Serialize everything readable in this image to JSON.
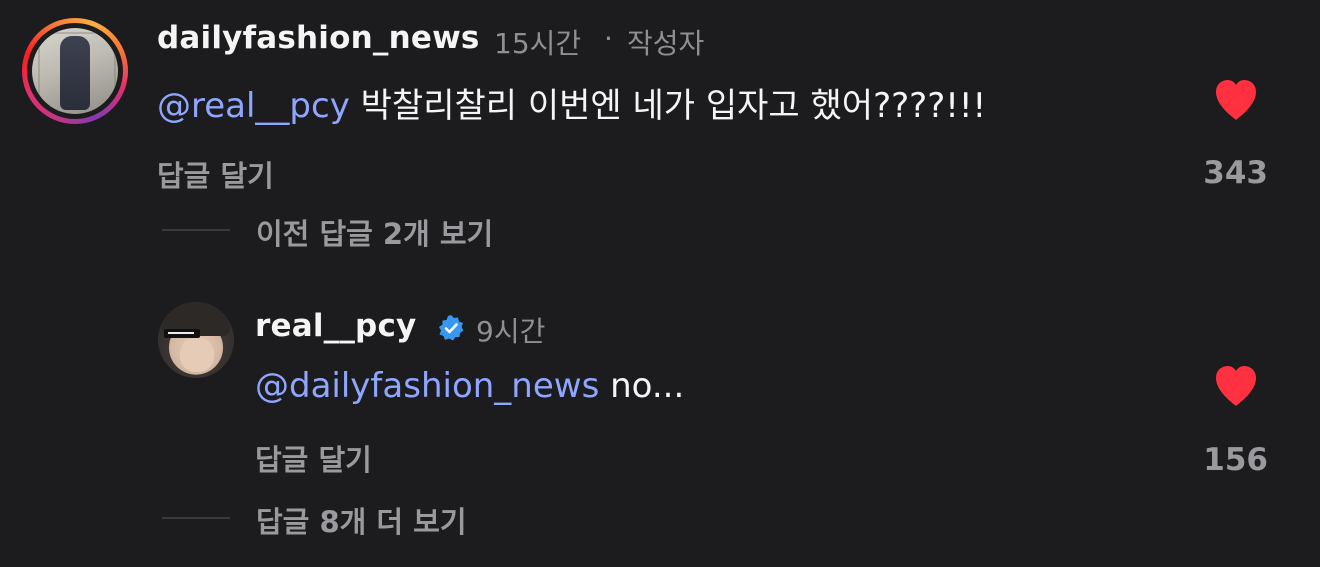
{
  "comment": {
    "username": "dailyfashion_news",
    "time": "15시간",
    "separator": "·",
    "author_badge": "작성자",
    "mention": "@real__pcy",
    "text": " 박찰리찰리 이번엔 네가 입자고 했어????!!!",
    "reply_label": "답글 달기",
    "likes": "343",
    "view_previous": "이전 답글 2개 보기",
    "icons": {
      "like": "heart-icon",
      "avatar": "profile-avatar"
    },
    "colors": {
      "heart": "#ff3040",
      "mention": "#8fa6ff"
    }
  },
  "reply": {
    "username": "real__pcy",
    "verified": true,
    "time": "9시간",
    "mention": "@dailyfashion_news",
    "text": " no...",
    "reply_label": "답글 달기",
    "likes": "156",
    "view_more": "답글 8개 더 보기",
    "icons": {
      "like": "heart-icon",
      "verified": "verified-badge-icon"
    },
    "colors": {
      "heart": "#ff3040",
      "verified": "#3897f0"
    }
  }
}
